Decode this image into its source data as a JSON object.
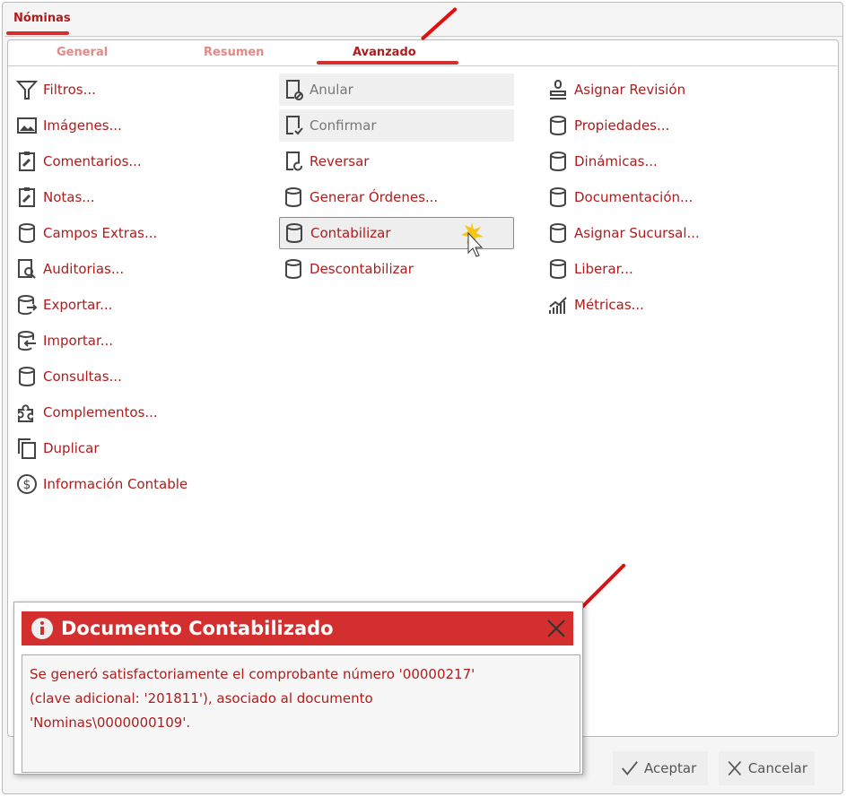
{
  "window": {
    "tab": "Nóminas"
  },
  "subtabs": [
    "General",
    "Resumen",
    "Avanzado"
  ],
  "columns": [
    [
      {
        "label": "Filtros...",
        "icon": "funnel-icon"
      },
      {
        "label": "Imágenes...",
        "icon": "image-icon"
      },
      {
        "label": "Comentarios...",
        "icon": "clipboard-edit-icon"
      },
      {
        "label": "Notas...",
        "icon": "clipboard-edit-icon"
      },
      {
        "label": "Campos Extras...",
        "icon": "database-icon"
      },
      {
        "label": "Auditorias...",
        "icon": "document-search-icon"
      },
      {
        "label": "Exportar...",
        "icon": "database-export-icon"
      },
      {
        "label": "Importar...",
        "icon": "database-import-icon"
      },
      {
        "label": "Consultas...",
        "icon": "database-icon"
      },
      {
        "label": "Complementos...",
        "icon": "puzzle-icon"
      },
      {
        "label": "Duplicar",
        "icon": "copy-icon"
      },
      {
        "label": "Información Contable",
        "icon": "dollar-circle-icon"
      }
    ],
    [
      {
        "label": "Anular",
        "icon": "document-cancel-icon",
        "state": "disabled"
      },
      {
        "label": "Confirmar",
        "icon": "document-check-icon",
        "state": "disabled"
      },
      {
        "label": "Reversar",
        "icon": "document-refresh-icon"
      },
      {
        "label": "Generar Órdenes...",
        "icon": "database-icon"
      },
      {
        "label": "Contabilizar",
        "icon": "database-icon",
        "state": "hover"
      },
      {
        "label": "Descontabilizar",
        "icon": "database-icon"
      }
    ],
    [
      {
        "label": "Asignar Revisión",
        "icon": "stamp-icon"
      },
      {
        "label": "Propiedades...",
        "icon": "database-icon"
      },
      {
        "label": "Dinámicas...",
        "icon": "database-icon"
      },
      {
        "label": "Documentación...",
        "icon": "database-icon"
      },
      {
        "label": "Asignar Sucursal...",
        "icon": "database-icon"
      },
      {
        "label": "Liberar...",
        "icon": "database-icon"
      },
      {
        "label": "Métricas...",
        "icon": "chart-bars-icon"
      }
    ]
  ],
  "footer": {
    "accept": "Aceptar",
    "cancel": "Cancelar"
  },
  "dialog": {
    "title": "Documento Contabilizado",
    "lines": [
      "Se generó satisfactoriamente el comprobante número '00000217'",
      "(clave adicional: '201811'), asociado al documento",
      "'Nominas\\0000000109'."
    ]
  },
  "colors": {
    "accent": "#d32f2f",
    "text": "#b01c1c"
  }
}
